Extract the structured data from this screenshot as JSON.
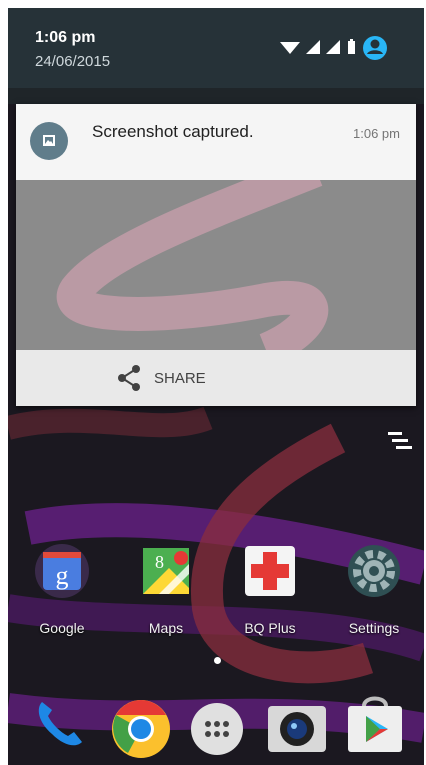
{
  "status": {
    "time": "1:06 pm",
    "date": "24/06/2015"
  },
  "notification": {
    "title": "Screenshot captured.",
    "time": "1:06 pm",
    "action_label": "SHARE"
  },
  "apps": [
    {
      "label": "Google"
    },
    {
      "label": "Maps"
    },
    {
      "label": "BQ Plus"
    },
    {
      "label": "Settings"
    }
  ],
  "icons": {
    "wifi": "wifi-icon",
    "signal": "signal-icon",
    "battery": "battery-icon",
    "account": "account-icon",
    "image": "image-icon",
    "share": "share-icon",
    "dismiss": "dismiss-all-icon"
  },
  "colors": {
    "header": "#263238",
    "accent": "#29b6f6"
  }
}
